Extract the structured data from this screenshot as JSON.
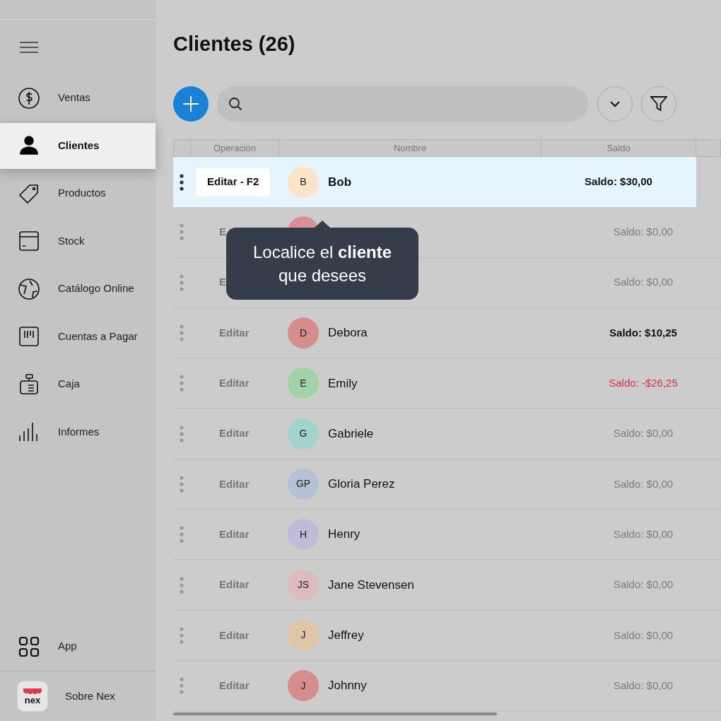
{
  "sidebar": {
    "items": [
      {
        "label": "Ventas",
        "selected": false
      },
      {
        "label": "Clientes",
        "selected": true
      },
      {
        "label": "Productos",
        "selected": false
      },
      {
        "label": "Stock",
        "selected": false
      },
      {
        "label": "Catálogo Online",
        "selected": false
      },
      {
        "label": "Cuentas a Pagar",
        "selected": false
      },
      {
        "label": "Caja",
        "selected": false
      },
      {
        "label": "Informes",
        "selected": false
      }
    ],
    "bottom": [
      {
        "label": "App"
      },
      {
        "label": "Sobre Nex",
        "logo_text": "nex"
      }
    ]
  },
  "title": "Clientes (26)",
  "table": {
    "columns": [
      "Operación",
      "Nombre",
      "Saldo"
    ],
    "rows": [
      {
        "operation": "Editar - F2",
        "initials": "B",
        "name": "Bob",
        "balance": "Saldo: $30,00",
        "kind": "positive",
        "color": "#fde3c7",
        "selected": true
      },
      {
        "operation": "E",
        "color": "#d98f94",
        "balance": "Saldo: $0,00",
        "kind": "zero",
        "selected": false
      },
      {
        "operation": "E",
        "balance": "Saldo: $0,00",
        "kind": "zero",
        "selected": false
      },
      {
        "operation": "Editar",
        "initials": "D",
        "name": "Debora",
        "balance": "Saldo: $10,25",
        "kind": "positive",
        "color": "#d68d8d",
        "selected": false
      },
      {
        "operation": "Editar",
        "initials": "E",
        "name": "Emily",
        "balance": "Saldo: -$26,25",
        "kind": "negative",
        "color": "#a3d2a6",
        "selected": false
      },
      {
        "operation": "Editar",
        "initials": "G",
        "name": "Gabriele",
        "balance": "Saldo: $0,00",
        "kind": "zero",
        "color": "#a2d3cf",
        "selected": false
      },
      {
        "operation": "Editar",
        "initials": "GP",
        "name": "Gloria Perez",
        "balance": "Saldo: $0,00",
        "kind": "zero",
        "color": "#b5c1d4",
        "selected": false
      },
      {
        "operation": "Editar",
        "initials": "H",
        "name": "Henry",
        "balance": "Saldo: $0,00",
        "kind": "zero",
        "color": "#c0bbd8",
        "selected": false
      },
      {
        "operation": "Editar",
        "initials": "JS",
        "name": "Jane Stevensen",
        "balance": "Saldo: $0,00",
        "kind": "zero",
        "color": "#dcbcbd",
        "selected": false
      },
      {
        "operation": "Editar",
        "initials": "J",
        "name": "Jeffrey",
        "balance": "Saldo: $0,00",
        "kind": "zero",
        "color": "#e0c6a8",
        "selected": false
      },
      {
        "operation": "Editar",
        "initials": "J",
        "name": "Johnny",
        "balance": "Saldo: $0,00",
        "kind": "zero",
        "color": "#d68d8d",
        "selected": false
      }
    ]
  },
  "tooltip": "Localice el **cliente** que desees"
}
